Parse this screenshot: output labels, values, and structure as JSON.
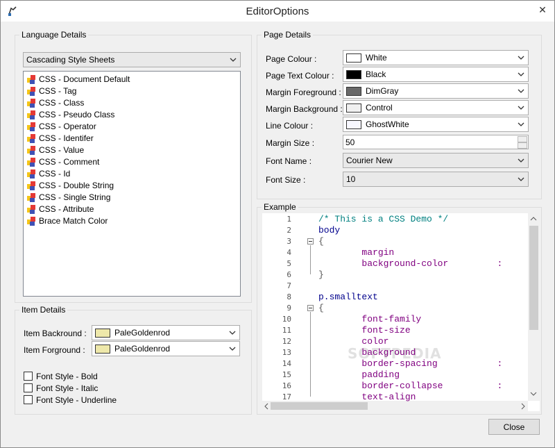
{
  "window": {
    "title": "EditorOptions",
    "close_label": "✕"
  },
  "language": {
    "group_title": "Language Details",
    "selected": "Cascading Style Sheets",
    "items": [
      "CSS - Document Default",
      "CSS - Tag",
      "CSS - Class",
      "CSS - Pseudo Class",
      "CSS - Operator",
      "CSS - Identifer",
      "CSS - Value",
      "CSS - Comment",
      "CSS - Id",
      "CSS - Double String",
      "CSS - Single String",
      "CSS - Attribute",
      "Brace Match Color"
    ]
  },
  "item": {
    "group_title": "Item Details",
    "backround_label": "Item Backround :",
    "backround_value": "PaleGoldenrod",
    "forground_label": "Item Forground :",
    "forground_value": "PaleGoldenrod",
    "swatch_color": "#EEE8AA",
    "bold_label": "Font Style - Bold",
    "italic_label": "Font Style - Italic",
    "underline_label": "Font Style - Underline"
  },
  "page": {
    "group_title": "Page Details",
    "page_colour_label": "Page Colour :",
    "page_colour": "White",
    "page_text_colour_label": "Page Text Colour :",
    "page_text_colour": "Black",
    "margin_fg_label": "Margin Foreground :",
    "margin_fg": "DimGray",
    "margin_bg_label": "Margin Background :",
    "margin_bg": "Control",
    "line_colour_label": "Line Colour :",
    "line_colour": "GhostWhite",
    "margin_size_label": "Margin Size :",
    "margin_size": "50",
    "font_name_label": "Font Name :",
    "font_name": "Courier New",
    "font_size_label": "Font Size :",
    "font_size": "10",
    "colors": {
      "white": "#FFFFFF",
      "black": "#000000",
      "dimgray": "#696969",
      "control": "#F0F0F0",
      "ghostwhite": "#F8F8FF"
    }
  },
  "example": {
    "group_title": "Example",
    "line_numbers": [
      "1",
      "2",
      "3",
      "4",
      "5",
      "6",
      "7",
      "8",
      "9",
      "10",
      "11",
      "12",
      "13",
      "14",
      "15",
      "16",
      "17"
    ],
    "lines": [
      "/* This is a CSS Demo */",
      "body",
      "{",
      "        margin",
      "        background-color         :",
      "}",
      "",
      "p.smalltext",
      "{",
      "        font-family",
      "        font-size",
      "        color",
      "        background",
      "        border-spacing           :",
      "        padding",
      "        border-collapse          :",
      "        text-align"
    ],
    "colors": {
      "comment": "#008080",
      "selector": "#00008B",
      "property": "#800080",
      "brace": "#555555"
    },
    "watermark": "SOFTPEDIA"
  },
  "footer": {
    "close_button": "Close"
  }
}
